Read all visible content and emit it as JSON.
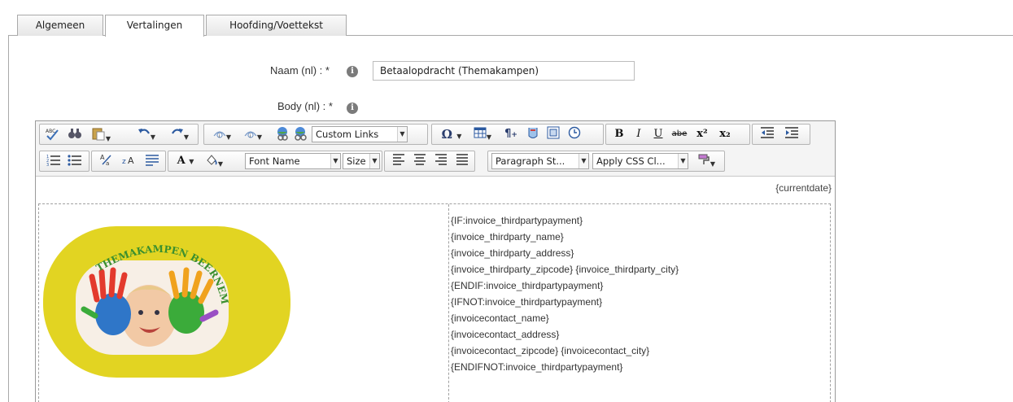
{
  "tabs": [
    {
      "label": "Algemeen",
      "active": false
    },
    {
      "label": "Vertalingen",
      "active": true
    },
    {
      "label": "Hoofding/Voettekst",
      "active": false
    }
  ],
  "form": {
    "name_label": "Naam (nl) : *",
    "name_value": "Betaalopdracht (Themakampen)",
    "body_label": "Body (nl) : *",
    "info_glyph": "i"
  },
  "toolbar": {
    "custom_links": "Custom Links",
    "font_name": "Font Name",
    "size": "Size",
    "paragraph_style": "Paragraph St...",
    "apply_css": "Apply CSS Cl...",
    "bold": "B",
    "italic": "I",
    "underline": "U",
    "strike": "abe",
    "superscript": "x²",
    "subscript": "x₂",
    "omega": "Ω",
    "font_color": "A",
    "pilcrow": "¶"
  },
  "document": {
    "currentdate": "{currentdate}",
    "logo_title": "THEMAKAMPEN BEERNEM",
    "address_lines": [
      "{IF:invoice_thirdpartypayment}",
      "{invoice_thirdparty_name}",
      "{invoice_thirdparty_address}",
      "{invoice_thirdparty_zipcode} {invoice_thirdparty_city}",
      "{ENDIF:invoice_thirdpartypayment}",
      "{IFNOT:invoice_thirdpartypayment}",
      "{invoicecontact_name}",
      "{invoicecontact_address}",
      "{invoicecontact_zipcode} {invoicecontact_city}",
      "{ENDIFNOT:invoice_thirdpartypayment}"
    ]
  },
  "colors": {
    "logo_yellow": "#e2d422",
    "logo_text": "#3a8f2e"
  }
}
